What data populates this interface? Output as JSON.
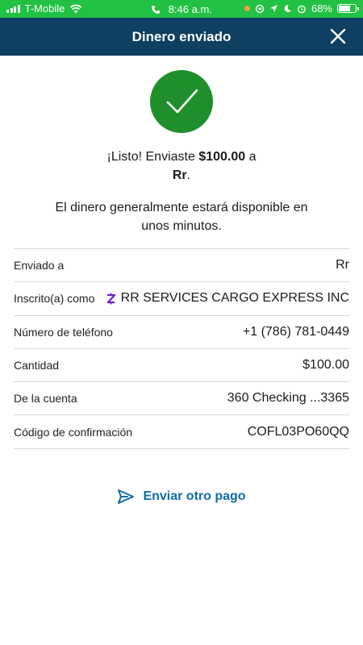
{
  "status_bar": {
    "carrier": "T-Mobile",
    "time": "8:46 a.m.",
    "battery": "68%",
    "battery_level": 0.68,
    "icons": [
      "signal-icon",
      "wifi-icon",
      "phone-icon",
      "location-icon",
      "alarm-icon",
      "orientation-lock-icon",
      "battery-icon"
    ]
  },
  "header": {
    "title": "Dinero enviado",
    "close_icon": "close-icon"
  },
  "confirmation": {
    "icon": "checkmark-icon",
    "color": "#1f8f2c",
    "prefix": "¡Listo! Enviaste ",
    "amount": "$100.00",
    "to": " a",
    "recipient": "Rr",
    "period": ".",
    "availability": "El dinero generalmente estará disponible en unos minutos."
  },
  "details": [
    {
      "label": "Enviado a",
      "value": "Rr"
    },
    {
      "label": "Inscrito(a) como",
      "value": "RR SERVICES CARGO EXPRESS INC",
      "icon": "zelle-icon"
    },
    {
      "label": "Número de teléfono",
      "value": "+1 (786) 781-0449"
    },
    {
      "label": "Cantidad",
      "value": "$100.00"
    },
    {
      "label": "De la cuenta",
      "value": "360 Checking ...3365"
    },
    {
      "label": "Código de confirmación",
      "value": "COFL03PO60QQ"
    }
  ],
  "action": {
    "label": "Enviar otro pago",
    "icon": "send-icon",
    "color": "#0f6da8"
  },
  "colors": {
    "status_bar": "#21c143",
    "header": "#0f3f61",
    "divider": "#d7d7d7"
  }
}
